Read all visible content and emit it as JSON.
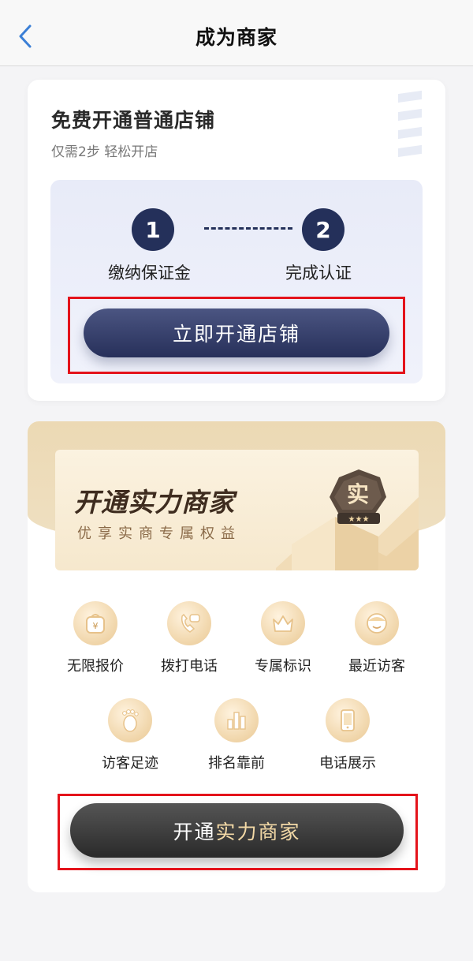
{
  "header": {
    "title": "成为商家",
    "back_icon": "chevron-left-icon"
  },
  "basic_store": {
    "title": "免费开通普通店铺",
    "subtitle": "仅需2步 轻松开店",
    "steps": [
      {
        "number": "1",
        "label": "缴纳保证金"
      },
      {
        "number": "2",
        "label": "完成认证"
      }
    ],
    "button_label": "立即开通店铺",
    "accent_color": "#24305a"
  },
  "premium": {
    "banner_title": "开通实力商家",
    "banner_subtitle": "优享实商专属权益",
    "badge_char": "实",
    "features": [
      {
        "label": "无限报价",
        "icon": "price-bag-icon"
      },
      {
        "label": "拨打电话",
        "icon": "phone-call-icon"
      },
      {
        "label": "专属标识",
        "icon": "crown-icon"
      },
      {
        "label": "最近访客",
        "icon": "visitor-face-icon"
      },
      {
        "label": "访客足迹",
        "icon": "footprint-icon"
      },
      {
        "label": "排名靠前",
        "icon": "ranking-icon"
      },
      {
        "label": "电话展示",
        "icon": "mobile-phone-icon"
      }
    ],
    "button_label_part1": "开通",
    "button_label_part2": "实力商家",
    "accent_color": "#f3d9a6"
  },
  "annotation_color": "#e4131b"
}
